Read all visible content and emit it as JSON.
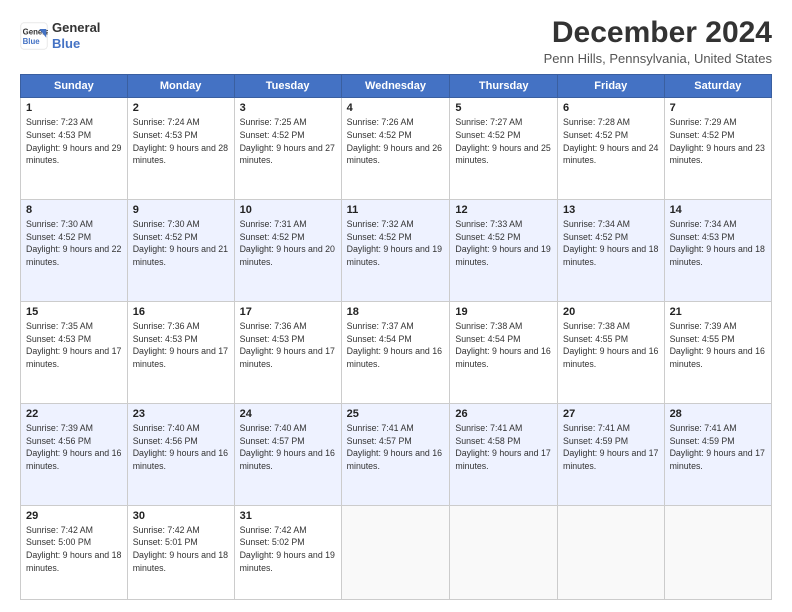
{
  "header": {
    "logo_line1": "General",
    "logo_line2": "Blue",
    "title": "December 2024",
    "subtitle": "Penn Hills, Pennsylvania, United States"
  },
  "weekdays": [
    "Sunday",
    "Monday",
    "Tuesday",
    "Wednesday",
    "Thursday",
    "Friday",
    "Saturday"
  ],
  "weeks": [
    [
      {
        "day": "1",
        "sunrise": "7:23 AM",
        "sunset": "4:53 PM",
        "daylight": "9 hours and 29 minutes."
      },
      {
        "day": "2",
        "sunrise": "7:24 AM",
        "sunset": "4:53 PM",
        "daylight": "9 hours and 28 minutes."
      },
      {
        "day": "3",
        "sunrise": "7:25 AM",
        "sunset": "4:52 PM",
        "daylight": "9 hours and 27 minutes."
      },
      {
        "day": "4",
        "sunrise": "7:26 AM",
        "sunset": "4:52 PM",
        "daylight": "9 hours and 26 minutes."
      },
      {
        "day": "5",
        "sunrise": "7:27 AM",
        "sunset": "4:52 PM",
        "daylight": "9 hours and 25 minutes."
      },
      {
        "day": "6",
        "sunrise": "7:28 AM",
        "sunset": "4:52 PM",
        "daylight": "9 hours and 24 minutes."
      },
      {
        "day": "7",
        "sunrise": "7:29 AM",
        "sunset": "4:52 PM",
        "daylight": "9 hours and 23 minutes."
      }
    ],
    [
      {
        "day": "8",
        "sunrise": "7:30 AM",
        "sunset": "4:52 PM",
        "daylight": "9 hours and 22 minutes."
      },
      {
        "day": "9",
        "sunrise": "7:30 AM",
        "sunset": "4:52 PM",
        "daylight": "9 hours and 21 minutes."
      },
      {
        "day": "10",
        "sunrise": "7:31 AM",
        "sunset": "4:52 PM",
        "daylight": "9 hours and 20 minutes."
      },
      {
        "day": "11",
        "sunrise": "7:32 AM",
        "sunset": "4:52 PM",
        "daylight": "9 hours and 19 minutes."
      },
      {
        "day": "12",
        "sunrise": "7:33 AM",
        "sunset": "4:52 PM",
        "daylight": "9 hours and 19 minutes."
      },
      {
        "day": "13",
        "sunrise": "7:34 AM",
        "sunset": "4:52 PM",
        "daylight": "9 hours and 18 minutes."
      },
      {
        "day": "14",
        "sunrise": "7:34 AM",
        "sunset": "4:53 PM",
        "daylight": "9 hours and 18 minutes."
      }
    ],
    [
      {
        "day": "15",
        "sunrise": "7:35 AM",
        "sunset": "4:53 PM",
        "daylight": "9 hours and 17 minutes."
      },
      {
        "day": "16",
        "sunrise": "7:36 AM",
        "sunset": "4:53 PM",
        "daylight": "9 hours and 17 minutes."
      },
      {
        "day": "17",
        "sunrise": "7:36 AM",
        "sunset": "4:53 PM",
        "daylight": "9 hours and 17 minutes."
      },
      {
        "day": "18",
        "sunrise": "7:37 AM",
        "sunset": "4:54 PM",
        "daylight": "9 hours and 16 minutes."
      },
      {
        "day": "19",
        "sunrise": "7:38 AM",
        "sunset": "4:54 PM",
        "daylight": "9 hours and 16 minutes."
      },
      {
        "day": "20",
        "sunrise": "7:38 AM",
        "sunset": "4:55 PM",
        "daylight": "9 hours and 16 minutes."
      },
      {
        "day": "21",
        "sunrise": "7:39 AM",
        "sunset": "4:55 PM",
        "daylight": "9 hours and 16 minutes."
      }
    ],
    [
      {
        "day": "22",
        "sunrise": "7:39 AM",
        "sunset": "4:56 PM",
        "daylight": "9 hours and 16 minutes."
      },
      {
        "day": "23",
        "sunrise": "7:40 AM",
        "sunset": "4:56 PM",
        "daylight": "9 hours and 16 minutes."
      },
      {
        "day": "24",
        "sunrise": "7:40 AM",
        "sunset": "4:57 PM",
        "daylight": "9 hours and 16 minutes."
      },
      {
        "day": "25",
        "sunrise": "7:41 AM",
        "sunset": "4:57 PM",
        "daylight": "9 hours and 16 minutes."
      },
      {
        "day": "26",
        "sunrise": "7:41 AM",
        "sunset": "4:58 PM",
        "daylight": "9 hours and 17 minutes."
      },
      {
        "day": "27",
        "sunrise": "7:41 AM",
        "sunset": "4:59 PM",
        "daylight": "9 hours and 17 minutes."
      },
      {
        "day": "28",
        "sunrise": "7:41 AM",
        "sunset": "4:59 PM",
        "daylight": "9 hours and 17 minutes."
      }
    ],
    [
      {
        "day": "29",
        "sunrise": "7:42 AM",
        "sunset": "5:00 PM",
        "daylight": "9 hours and 18 minutes."
      },
      {
        "day": "30",
        "sunrise": "7:42 AM",
        "sunset": "5:01 PM",
        "daylight": "9 hours and 18 minutes."
      },
      {
        "day": "31",
        "sunrise": "7:42 AM",
        "sunset": "5:02 PM",
        "daylight": "9 hours and 19 minutes."
      },
      null,
      null,
      null,
      null
    ]
  ]
}
